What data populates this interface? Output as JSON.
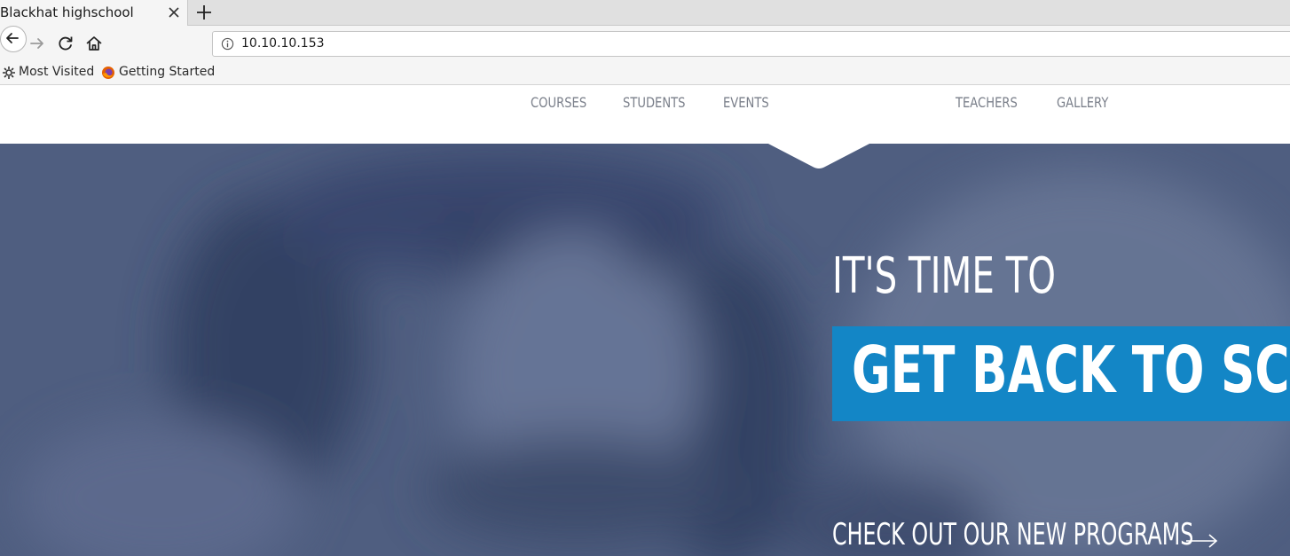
{
  "browser": {
    "tab_title": "Blackhat highschool",
    "url": "10.10.10.153",
    "bookmarks": [
      {
        "label": "Most Visited",
        "icon": "gear-icon"
      },
      {
        "label": "Getting Started",
        "icon": "firefox-icon"
      }
    ]
  },
  "site": {
    "menu": [
      "COURSES",
      "STUDENTS",
      "EVENTS",
      "TEACHERS",
      "GALLERY"
    ],
    "hero": {
      "kicker": "IT'S TIME TO",
      "headline": "GET BACK TO SCHOOL",
      "cta": "CHECK OUT OUR NEW PROGRAMS"
    },
    "colors": {
      "hero_overlay": "#4f5e80",
      "banner": "#1386c6",
      "menu_text": "#7a7f8a"
    }
  }
}
